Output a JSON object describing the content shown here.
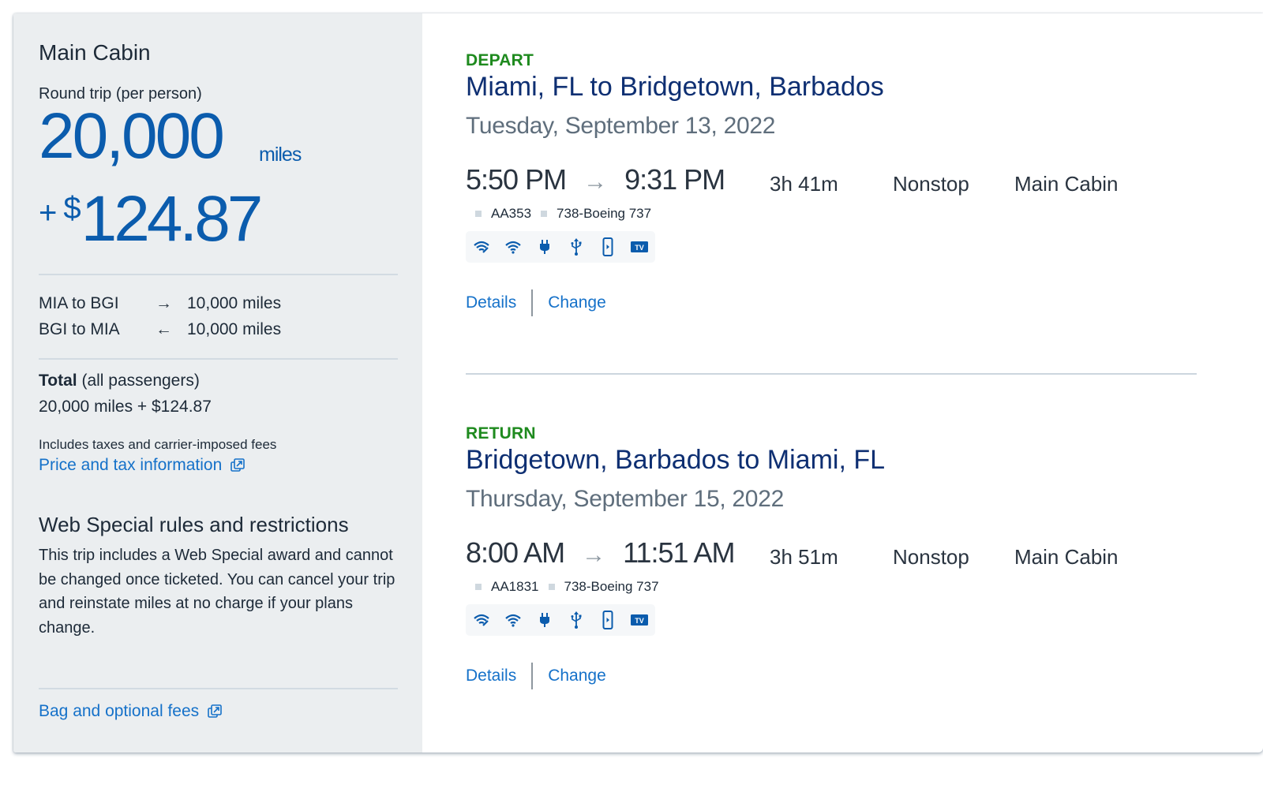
{
  "summary": {
    "cabin_title": "Main Cabin",
    "round_trip_label": "Round trip (per person)",
    "miles_value": "20,000",
    "miles_unit": "miles",
    "price_plus": "+",
    "price_currency": "$",
    "price_value": "124.87",
    "segments": [
      {
        "route": "MIA to BGI",
        "direction_icon": "arrow-right-icon",
        "arrow": "→",
        "miles": "10,000 miles"
      },
      {
        "route": "BGI to MIA",
        "direction_icon": "arrow-left-icon",
        "arrow": "←",
        "miles": "10,000 miles"
      }
    ],
    "total_label": "Total",
    "total_qualifier": "(all passengers)",
    "total_amount": "20,000 miles + $124.87",
    "fees_note": "Includes taxes and carrier-imposed fees",
    "price_tax_link": "Price and tax information",
    "rules_title": "Web Special rules and restrictions",
    "rules_body": "This trip includes a Web Special award and cannot be changed once ticketed. You can cancel your trip and reinstate miles at no charge if your plans change.",
    "bag_fees_link": "Bag and optional fees",
    "external_link_icon": "external-link-icon"
  },
  "trips": [
    {
      "tag": "DEPART",
      "route": "Miami, FL to Bridgetown, Barbados",
      "date": "Tuesday, September 13, 2022",
      "depart_time": "5:50 PM",
      "arrive_time": "9:31 PM",
      "duration": "3h 41m",
      "stops": "Nonstop",
      "cabin": "Main Cabin",
      "flight_number": "AA353",
      "aircraft": "738-Boeing 737",
      "amenities": [
        "wifi-satellite-icon",
        "wifi-icon",
        "power-outlet-icon",
        "usb-icon",
        "device-entertainment-icon",
        "tv-icon"
      ],
      "details_label": "Details",
      "change_label": "Change"
    },
    {
      "tag": "RETURN",
      "route": "Bridgetown, Barbados to Miami, FL",
      "date": "Thursday, September 15, 2022",
      "depart_time": "8:00 AM",
      "arrive_time": "11:51 AM",
      "duration": "3h 51m",
      "stops": "Nonstop",
      "cabin": "Main Cabin",
      "flight_number": "AA1831",
      "aircraft": "738-Boeing 737",
      "amenities": [
        "wifi-satellite-icon",
        "wifi-icon",
        "power-outlet-icon",
        "usb-icon",
        "device-entertainment-icon",
        "tv-icon"
      ],
      "details_label": "Details",
      "change_label": "Change"
    }
  ],
  "tv_label": "TV",
  "colors": {
    "brand_blue": "#0b5cad",
    "link_blue": "#1571c9",
    "route_navy": "#0e2f72",
    "tag_green": "#1e8a1e",
    "sidebar_bg": "#ebeef0"
  }
}
